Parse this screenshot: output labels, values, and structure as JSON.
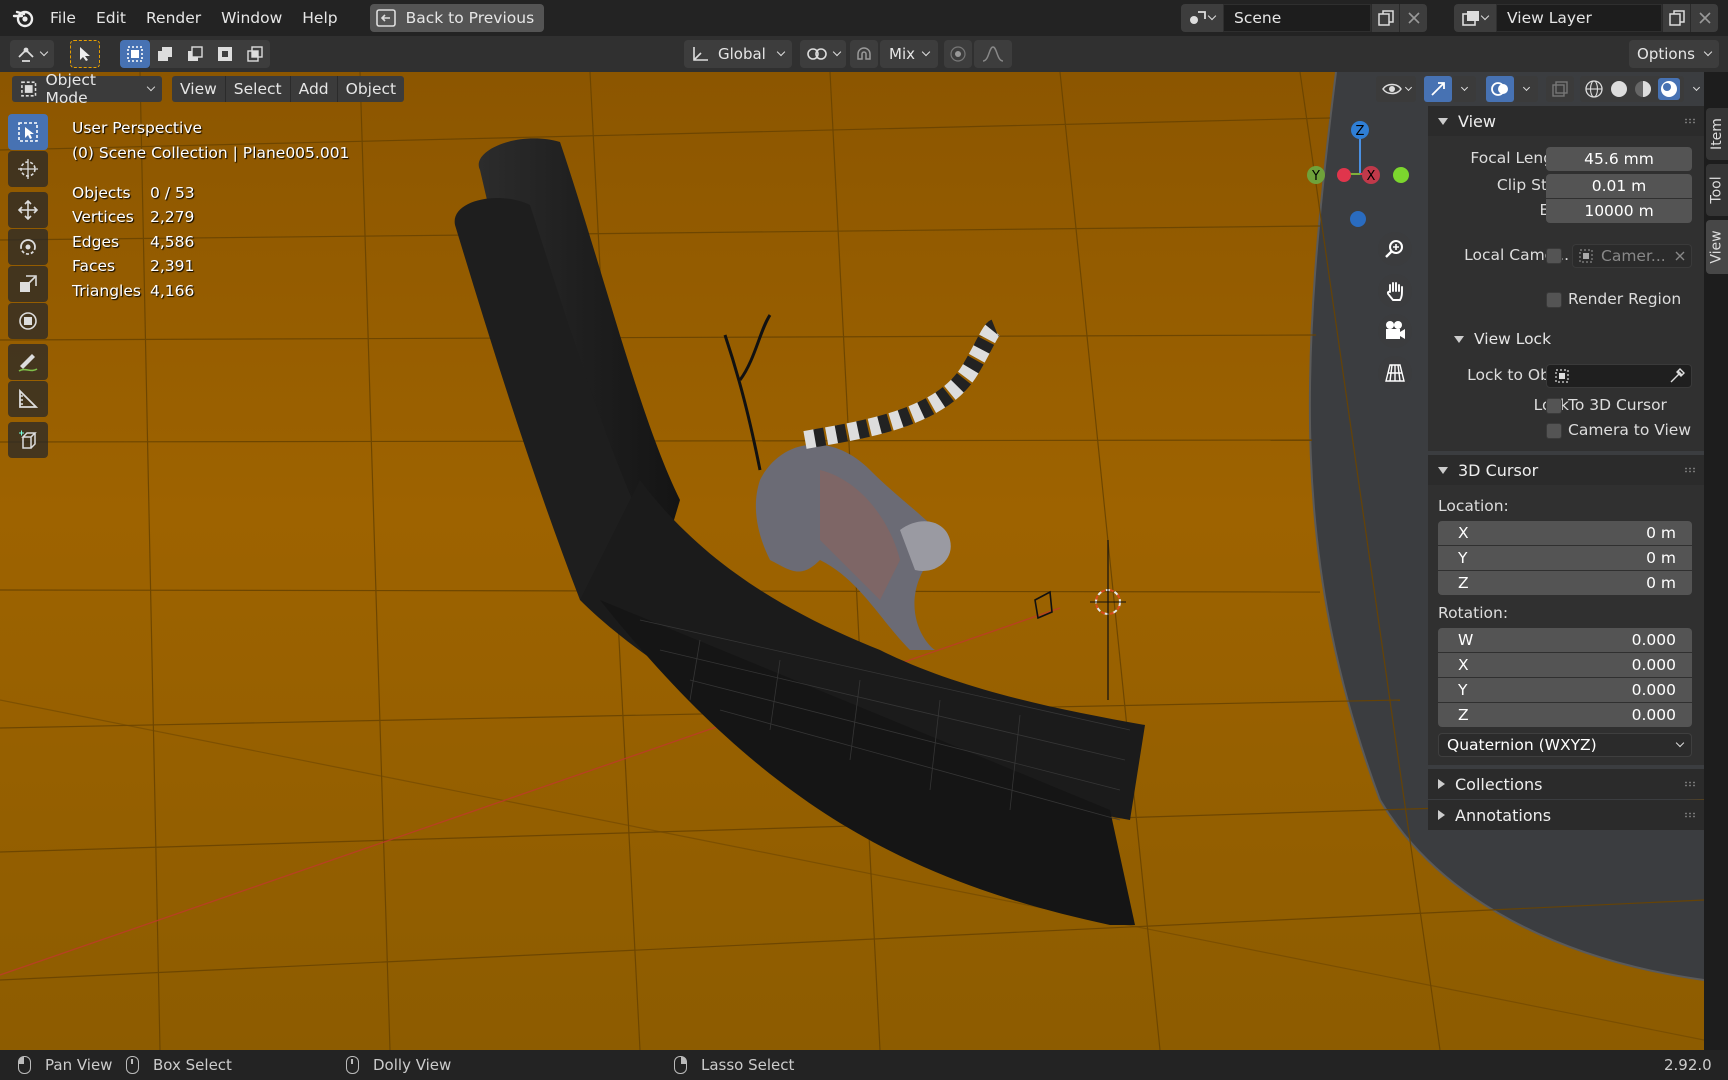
{
  "menu": {
    "items": [
      "File",
      "Edit",
      "Render",
      "Window",
      "Help"
    ],
    "back_label": "Back to Previous"
  },
  "scene_selector": {
    "value": "Scene"
  },
  "view_layer_selector": {
    "value": "View Layer"
  },
  "tool_header": {
    "orientation": "Global",
    "falloff_mode": "Mix",
    "options_label": "Options"
  },
  "viewport_header": {
    "mode": "Object Mode",
    "menus": [
      "View",
      "Select",
      "Add",
      "Object"
    ]
  },
  "overlay": {
    "perspective": "User Perspective",
    "collection": "(0) Scene Collection | Plane005.001",
    "stats": [
      {
        "label": "Objects",
        "value": "0 / 53"
      },
      {
        "label": "Vertices",
        "value": "2,279"
      },
      {
        "label": "Edges",
        "value": "4,586"
      },
      {
        "label": "Faces",
        "value": "2,391"
      },
      {
        "label": "Triangles",
        "value": "4,166"
      }
    ]
  },
  "gizmo": {
    "z": "Z",
    "y": "Y",
    "x": "X"
  },
  "npanel": {
    "view": {
      "title": "View",
      "focal_length_label": "Focal Length",
      "focal_length": "45.6 mm",
      "clip_start_label": "Clip Start",
      "clip_start": "0.01 m",
      "clip_end_label": "End",
      "clip_end": "10000 m",
      "local_camera_label": "Local Came...",
      "local_camera_value": "Camer...",
      "render_region_label": "Render Region"
    },
    "view_lock": {
      "title": "View Lock",
      "lock_to_object_label": "Lock to Obj...",
      "lock_label": "Lock",
      "to_3d_cursor_label": "To 3D Cursor",
      "camera_to_view_label": "Camera to View"
    },
    "cursor": {
      "title": "3D Cursor",
      "location_label": "Location:",
      "location": [
        {
          "axis": "X",
          "value": "0 m"
        },
        {
          "axis": "Y",
          "value": "0 m"
        },
        {
          "axis": "Z",
          "value": "0 m"
        }
      ],
      "rotation_label": "Rotation:",
      "rotation": [
        {
          "axis": "W",
          "value": "0.000"
        },
        {
          "axis": "X",
          "value": "0.000"
        },
        {
          "axis": "Y",
          "value": "0.000"
        },
        {
          "axis": "Z",
          "value": "0.000"
        }
      ],
      "rotation_mode": "Quaternion (WXYZ)"
    },
    "collections_title": "Collections",
    "annotations_title": "Annotations"
  },
  "side_tabs": [
    "Item",
    "Tool",
    "View"
  ],
  "status": {
    "pan": "Pan View",
    "box": "Box Select",
    "dolly": "Dolly View",
    "lasso": "Lasso Select",
    "version": "2.92.0"
  },
  "colors": {
    "accent": "#4772b3",
    "viewport_bg": "#9a5f00",
    "panel": "#303030",
    "header": "#232323"
  }
}
